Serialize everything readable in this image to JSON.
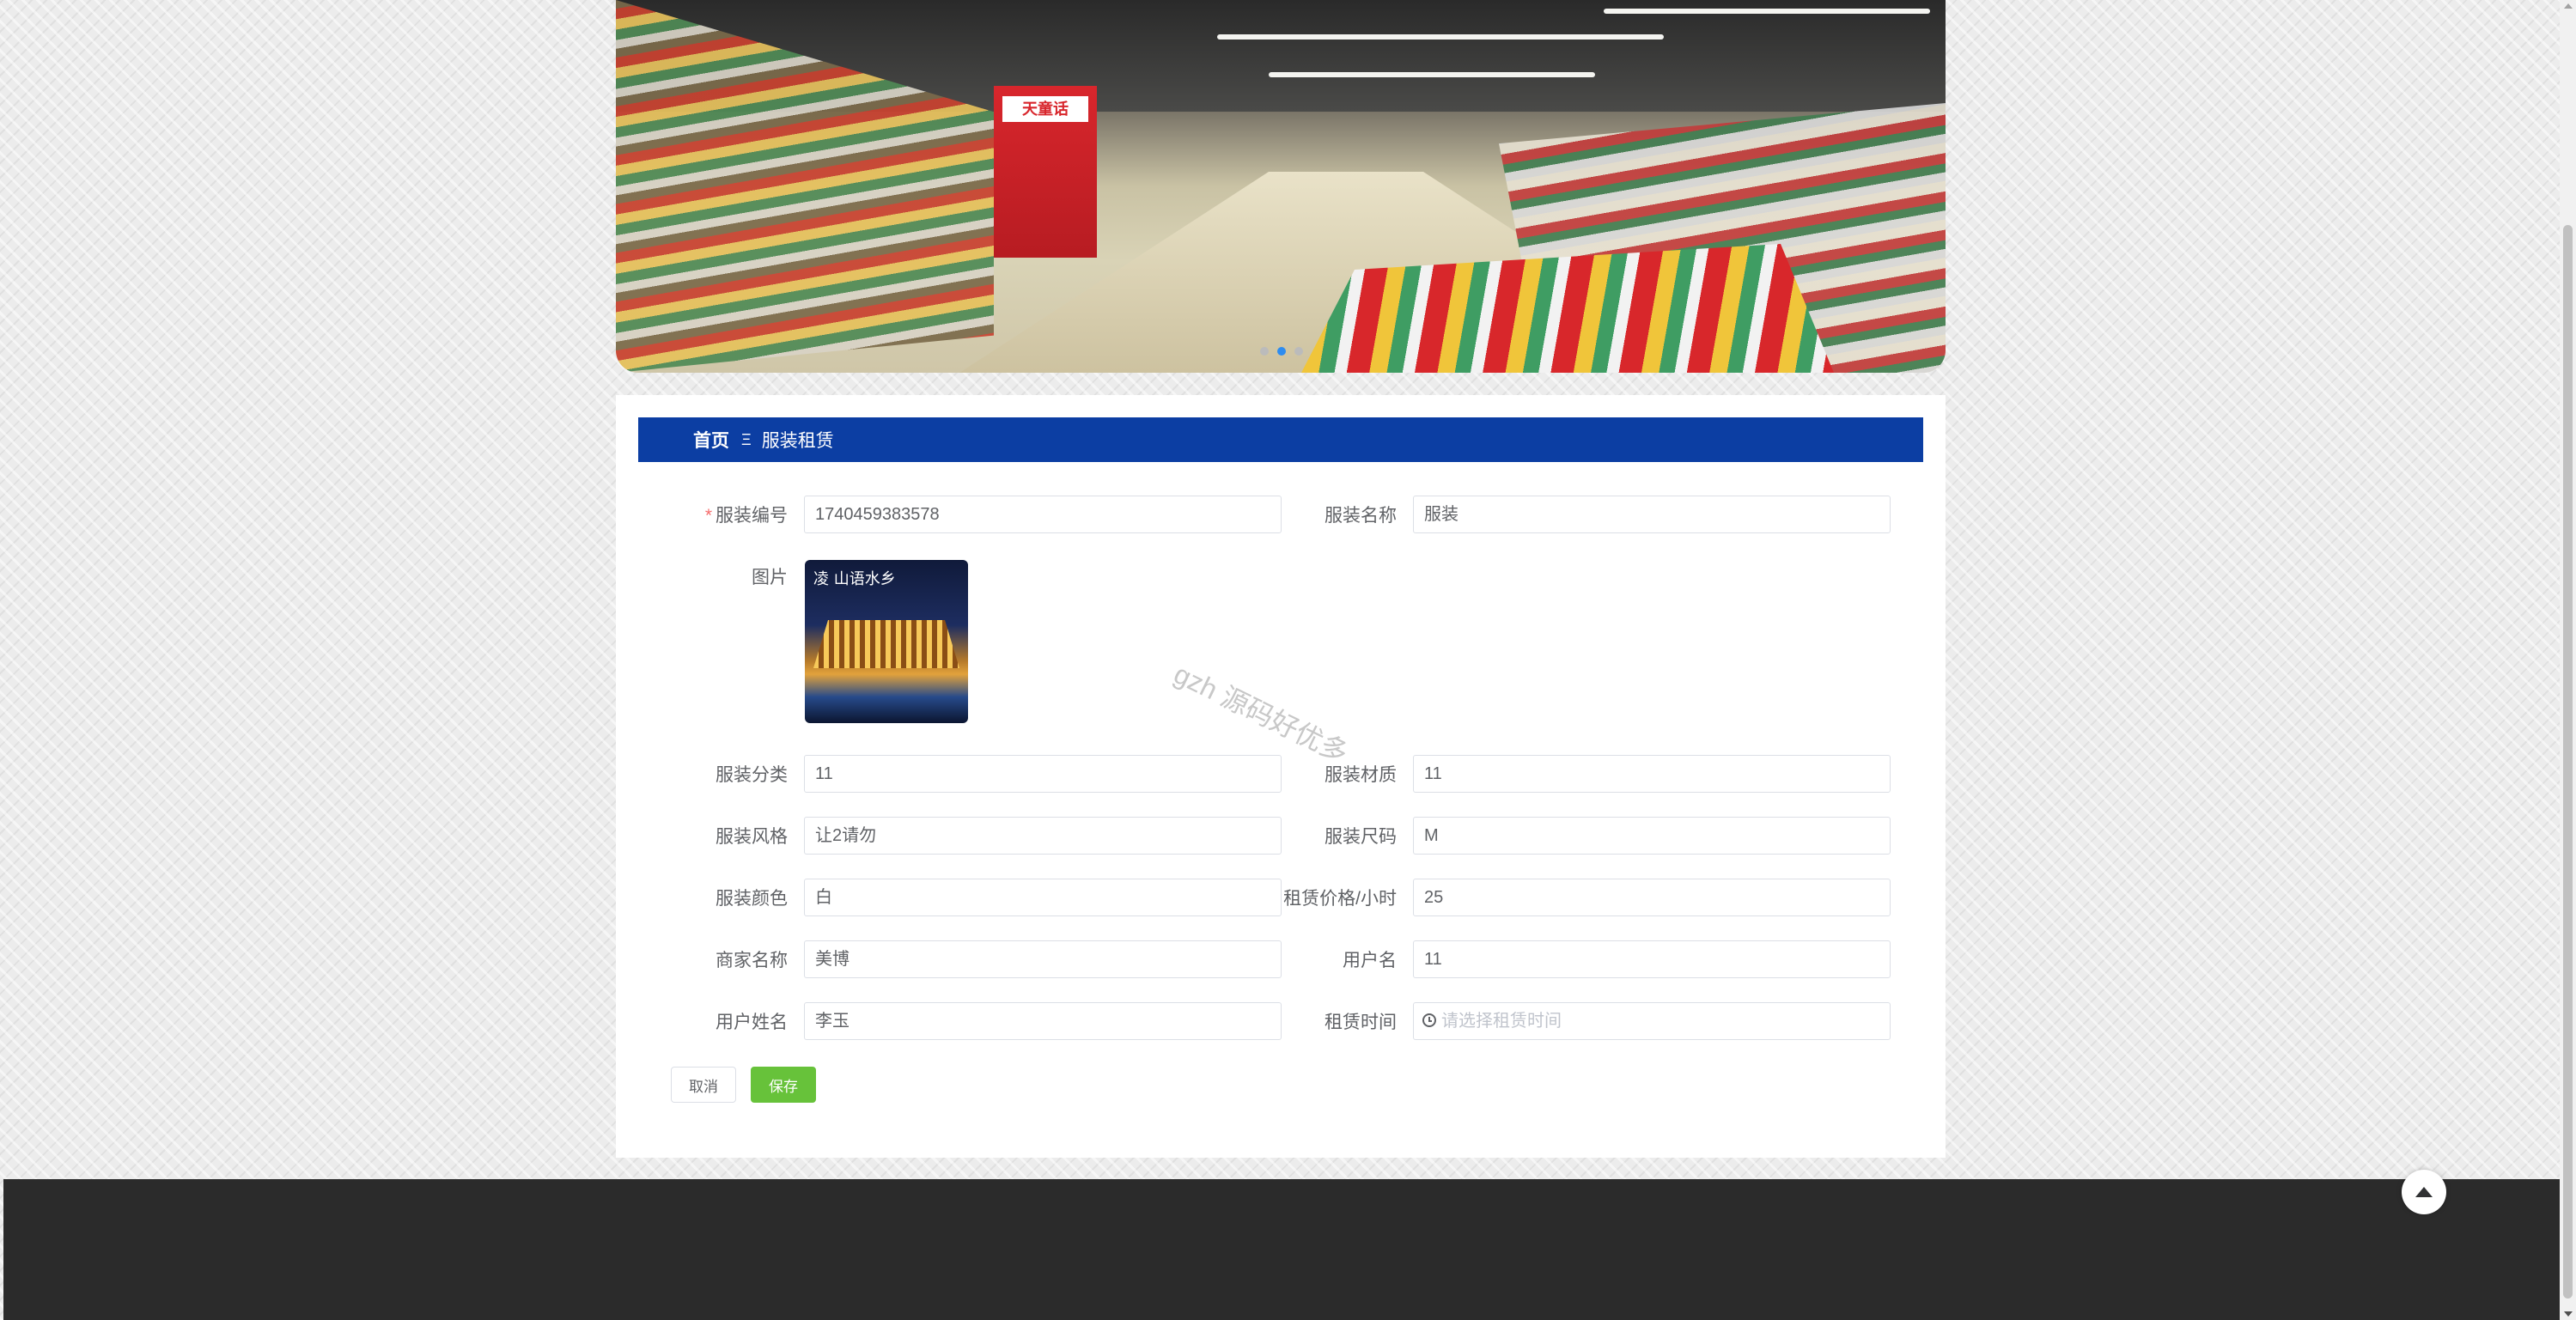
{
  "banner": {
    "store_sign": "天童话",
    "slides": 3,
    "active_slide": 2
  },
  "breadcrumb": {
    "home": "首页",
    "separator": "Ξ",
    "current": "服装租赁"
  },
  "form": {
    "clothing_no": {
      "label": "服装编号",
      "required": true,
      "value": "1740459383578"
    },
    "clothing_name": {
      "label": "服装名称",
      "value": "服装"
    },
    "image": {
      "label": "图片",
      "script": "凌 山语水乡"
    },
    "category": {
      "label": "服装分类",
      "value": "11"
    },
    "material": {
      "label": "服装材质",
      "value": "11"
    },
    "style": {
      "label": "服装风格",
      "value": "让2请勿"
    },
    "size": {
      "label": "服装尺码",
      "value": "M"
    },
    "color": {
      "label": "服装颜色",
      "value": "白"
    },
    "price": {
      "label": "租赁价格/小时",
      "value": "25"
    },
    "merchant": {
      "label": "商家名称",
      "value": "美博"
    },
    "username": {
      "label": "用户名",
      "value": "11"
    },
    "real_name": {
      "label": "用户姓名",
      "value": "李玉"
    },
    "rent_time": {
      "label": "租赁时间",
      "placeholder": "请选择租赁时间"
    }
  },
  "buttons": {
    "cancel": "取消",
    "save": "保存"
  },
  "watermark": "gzh 源码好优多",
  "colors": {
    "breadcrumb_bg": "#0c3ea3",
    "save_button": "#67c23a",
    "footer_bg": "#2b2b2b"
  }
}
